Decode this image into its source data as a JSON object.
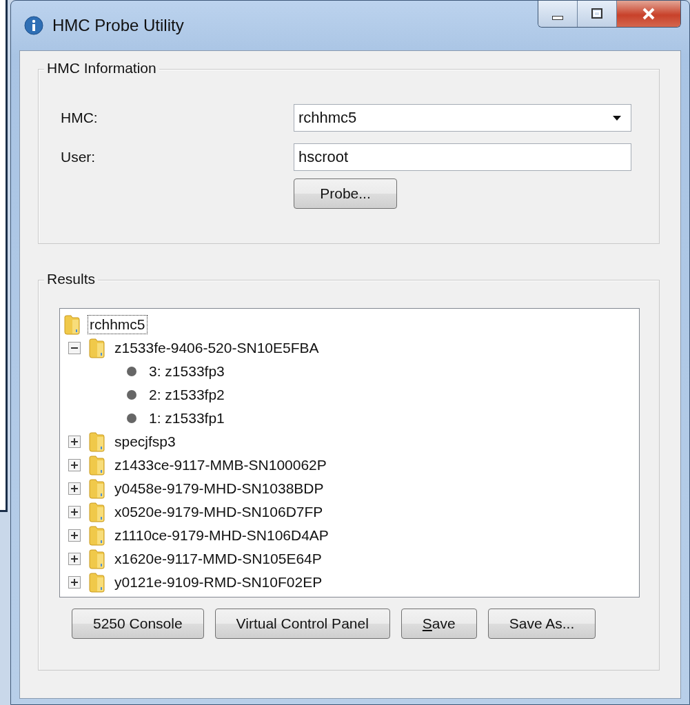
{
  "window": {
    "title": "HMC Probe Utility"
  },
  "hmc_information": {
    "title": "HMC Information",
    "fields": [
      {
        "kind": "combo",
        "label": "HMC:",
        "value": "rchhmc5"
      },
      {
        "kind": "text",
        "label": "User:",
        "value": "hscroot"
      }
    ],
    "probe_button": "Probe..."
  },
  "results": {
    "title": "Results",
    "tree": {
      "label": "rchhmc5",
      "kind": "folder",
      "focused": true,
      "children": [
        {
          "label": "z1533fe-9406-520-SN10E5FBA",
          "kind": "folder",
          "expanded": true,
          "children": [
            {
              "label": "3: z1533fp3",
              "kind": "partition"
            },
            {
              "label": "2: z1533fp2",
              "kind": "partition"
            },
            {
              "label": "1: z1533fp1",
              "kind": "partition"
            }
          ]
        },
        {
          "label": "specjfsp3",
          "kind": "folder",
          "expanded": false
        },
        {
          "label": "z1433ce-9117-MMB-SN100062P",
          "kind": "folder",
          "expanded": false
        },
        {
          "label": "y0458e-9179-MHD-SN1038BDP",
          "kind": "folder",
          "expanded": false
        },
        {
          "label": "x0520e-9179-MHD-SN106D7FP",
          "kind": "folder",
          "expanded": false
        },
        {
          "label": "z1110ce-9179-MHD-SN106D4AP",
          "kind": "folder",
          "expanded": false
        },
        {
          "label": "x1620e-9117-MMD-SN105E64P",
          "kind": "folder",
          "expanded": false
        },
        {
          "label": "y0121e-9109-RMD-SN10F02EP",
          "kind": "folder",
          "expanded": false
        }
      ]
    },
    "buttons": [
      {
        "label": "5250 Console"
      },
      {
        "label": "Virtual Control Panel"
      },
      {
        "label": "Save",
        "first_letter_underlined": true
      },
      {
        "label": "Save As..."
      }
    ]
  }
}
